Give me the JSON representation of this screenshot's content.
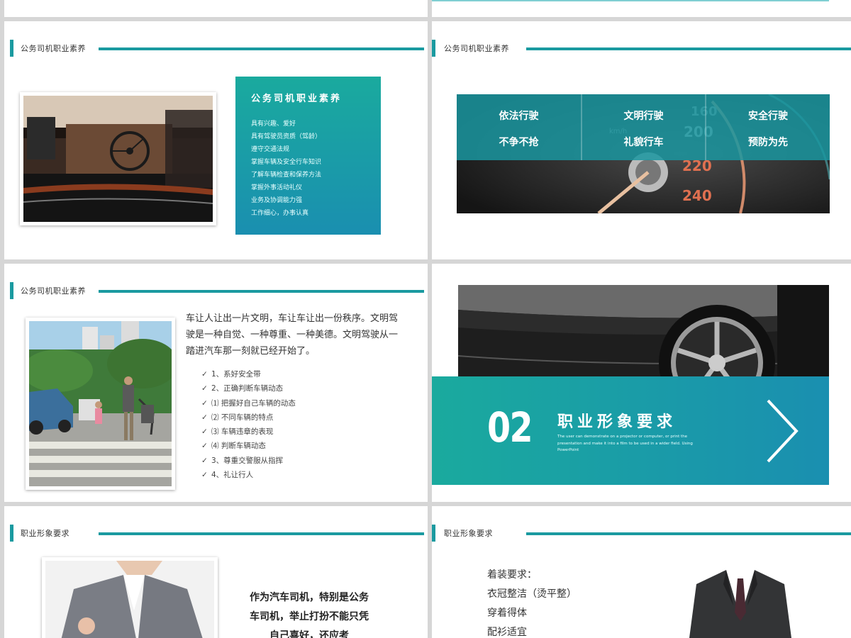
{
  "slide_common": {
    "section1_title": "公务司机职业素养",
    "section2_title": "职业形象要求"
  },
  "slide2": {
    "box_title": "公务司机职业素养",
    "items": [
      "具有兴趣、爱好",
      "具有驾驶员资质（驾龄）",
      "遵守交通法规",
      "掌握车辆及安全行车知识",
      "了解车辆检查和保养方法",
      "掌握外事活动礼仪",
      "业务及协调能力强",
      "工作细心，办事认真"
    ]
  },
  "slide3": {
    "cells": [
      {
        "line1": "依法行驶",
        "line2": "不争不抢"
      },
      {
        "line1": "文明行驶",
        "line2": "礼貌行车"
      },
      {
        "line1": "安全行驶",
        "line2": "预防为先"
      }
    ]
  },
  "slide4": {
    "paragraph": "车让人让出一片文明，车让车让出一份秩序。文明驾驶是一种自觉、一种尊重、一种美德。文明驾驶从一踏进汽车那一刻就已经开始了。",
    "items": [
      "1、系好安全带",
      "2、正确判断车辆动态",
      "⑴ 把握好自己车辆的动态",
      "⑵ 不同车辆的特点",
      "⑶ 车辆违章的表现",
      "⑷ 判断车辆动态",
      "3、尊重交警服从指挥",
      "4、礼让行人"
    ],
    "check_mark": "✓"
  },
  "slide5": {
    "number": "02",
    "title": "职业形象要求",
    "desc": "The user can demonstrate on a projector or computer, or print the presentation and make it into a film to be used in a wider field. Using PowerPoint"
  },
  "slide6": {
    "text": "作为汽车司机，特别是公务车司机，举止打扮不能只凭自己喜好，还应考"
  },
  "slide7": {
    "lines": [
      "着装要求：",
      "衣冠整洁（烫平整）",
      "穿着得体",
      "配衫适宜"
    ]
  },
  "colors": {
    "accent": "#1a9aa0",
    "gradient_start": "#1aaa9e",
    "gradient_end": "#1a8fb0"
  }
}
